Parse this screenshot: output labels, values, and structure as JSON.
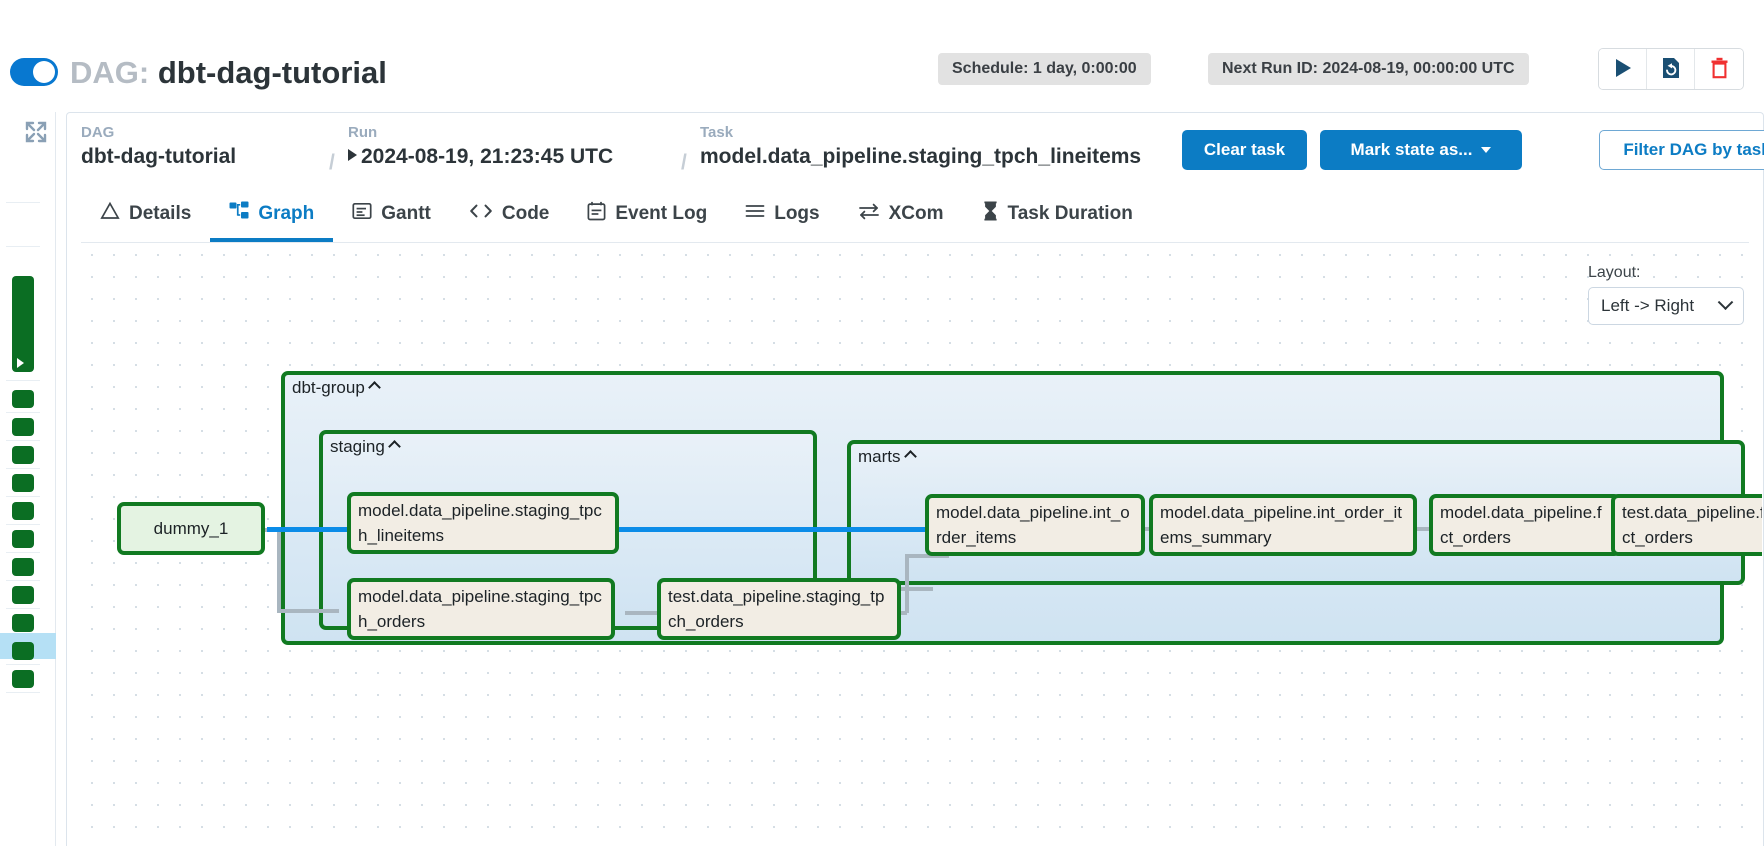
{
  "header": {
    "toggle_state": "on",
    "dag_prefix": "DAG:",
    "dag_name": "dbt-dag-tutorial",
    "schedule_pill": "Schedule: 1 day, 0:00:00",
    "next_run_pill": "Next Run ID: 2024-08-19, 00:00:00 UTC",
    "actions": [
      {
        "name": "trigger-dag-button",
        "icon": "play-icon"
      },
      {
        "name": "refresh-dag-button",
        "icon": "rerun-icon"
      },
      {
        "name": "delete-dag-button",
        "icon": "trash-icon"
      }
    ],
    "accent_blue": "#0c7cc4",
    "toggle_blue": "#0878d0",
    "delete_red": "#f03030",
    "navy": "#1a4f73"
  },
  "breadcrumb": {
    "dag_label": "DAG",
    "dag_value": "dbt-dag-tutorial",
    "run_label": "Run",
    "run_value": "2024-08-19, 21:23:45 UTC",
    "task_label": "Task",
    "task_value": "model.data_pipeline.staging_tpch_lineitems",
    "separator": "/"
  },
  "toolbar": {
    "clear_task": "Clear task",
    "mark_state": "Mark state as...",
    "filter_dag": "Filter DAG by task"
  },
  "tabs": [
    {
      "label": "Details",
      "icon": "warning-triangle-icon",
      "active": false
    },
    {
      "label": "Graph",
      "icon": "graph-nodes-icon",
      "active": true
    },
    {
      "label": "Gantt",
      "icon": "gantt-bars-icon",
      "active": false
    },
    {
      "label": "Code",
      "icon": "code-brackets-icon",
      "active": false
    },
    {
      "label": "Event Log",
      "icon": "calendar-list-icon",
      "active": false
    },
    {
      "label": "Logs",
      "icon": "hamburger-lines-icon",
      "active": false
    },
    {
      "label": "XCom",
      "icon": "exchange-arrows-icon",
      "active": false
    },
    {
      "label": "Task Duration",
      "icon": "hourglass-icon",
      "active": false
    }
  ],
  "graph": {
    "layout_label": "Layout:",
    "layout_value": "Left -> Right",
    "groups": [
      {
        "id": "dbt-group",
        "label": "dbt-group",
        "collapsed": false
      },
      {
        "id": "staging",
        "label": "staging",
        "collapsed": false
      },
      {
        "id": "marts",
        "label": "marts",
        "collapsed": false
      }
    ],
    "nodes": [
      {
        "id": "dummy_1",
        "label": "dummy_1",
        "state": "success",
        "selected": false
      },
      {
        "id": "stg_lineitems",
        "label": "model.data_pipeline.staging_tpch_lineitems",
        "state": "success",
        "selected": true
      },
      {
        "id": "stg_orders",
        "label": "model.data_pipeline.staging_tpch_orders",
        "state": "success",
        "selected": false
      },
      {
        "id": "test_stg_orders",
        "label": "test.data_pipeline.staging_tpch_orders",
        "state": "success",
        "selected": false
      },
      {
        "id": "int_order_items",
        "label": "model.data_pipeline.int_order_items",
        "state": "success",
        "selected": false
      },
      {
        "id": "int_summary",
        "label": "model.data_pipeline.int_order_items_summary",
        "state": "success",
        "selected": false
      },
      {
        "id": "fct_orders",
        "label": "model.data_pipeline.fct_orders",
        "state": "success",
        "selected": false
      },
      {
        "id": "test_fct_orders",
        "label": "test.data_pipeline.fct_orders",
        "state": "success",
        "selected": false
      }
    ],
    "edge_color": "#a9b6c0",
    "edge_highlight_color": "#0b8ce8",
    "node_border_color": "#117a21",
    "node_fill": "#f2ede4",
    "dummy_fill": "#e4f3e2"
  },
  "grid_strip": {
    "expand_icon": "expand-arrows-icon",
    "dag_run_state": "success",
    "task_states": [
      "success",
      "success",
      "success",
      "success",
      "success",
      "success",
      "success",
      "success",
      "success",
      "success",
      "success"
    ],
    "selected_task_index": 5,
    "success_color": "#0b6e23",
    "highlight_color": "#b5e0f5"
  }
}
